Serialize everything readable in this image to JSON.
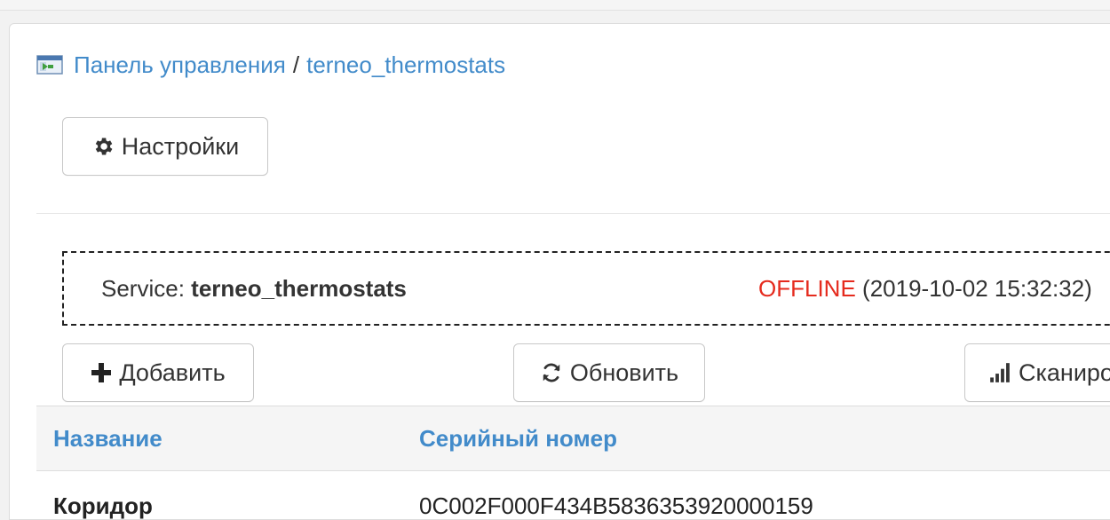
{
  "breadcrumb": {
    "home_label": "Панель управления",
    "separator": "/",
    "current_label": "terneo_thermostats"
  },
  "toolbar": {
    "settings_label": "Настройки"
  },
  "service": {
    "prefix": "Service:",
    "name": "terneo_thermostats",
    "status": "OFFLINE",
    "timestamp": "(2019-10-02 15:32:32)",
    "status_color": "#e52b1e"
  },
  "actions": {
    "add_label": "Добавить",
    "refresh_label": "Обновить",
    "scan_label": "Сканировать"
  },
  "table": {
    "columns": [
      "Название",
      "Серийный номер"
    ],
    "rows": [
      {
        "name": "Коридор",
        "serial": "0C002F000F434B583635392000015​9"
      }
    ]
  },
  "icons": {
    "breadcrumb": "control-panel-icon",
    "settings": "gear-icon",
    "add": "plus-icon",
    "refresh": "refresh-icon",
    "scan": "signal-bars-icon"
  },
  "colors": {
    "link": "#428bca",
    "offline": "#e52b1e"
  }
}
